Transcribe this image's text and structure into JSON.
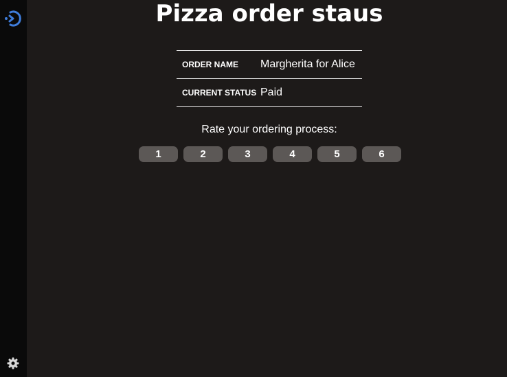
{
  "sidebar": {
    "logo_icon": "app-logo-icon",
    "settings_icon": "gear-icon",
    "accent_color": "#3f7ddb"
  },
  "main": {
    "title": "Pizza order staus",
    "order": {
      "rows": [
        {
          "label": "ORDER NAME",
          "value": "Margherita for Alice"
        },
        {
          "label": "CURRENT STATUS",
          "value": "Paid"
        }
      ]
    },
    "rating": {
      "prompt": "Rate your ordering process:",
      "options": [
        "1",
        "2",
        "3",
        "4",
        "5",
        "6"
      ]
    }
  },
  "colors": {
    "background": "#1d1a19",
    "sidebar": "#0a0a0a",
    "button": "#5c5856",
    "text": "#ffffff"
  }
}
